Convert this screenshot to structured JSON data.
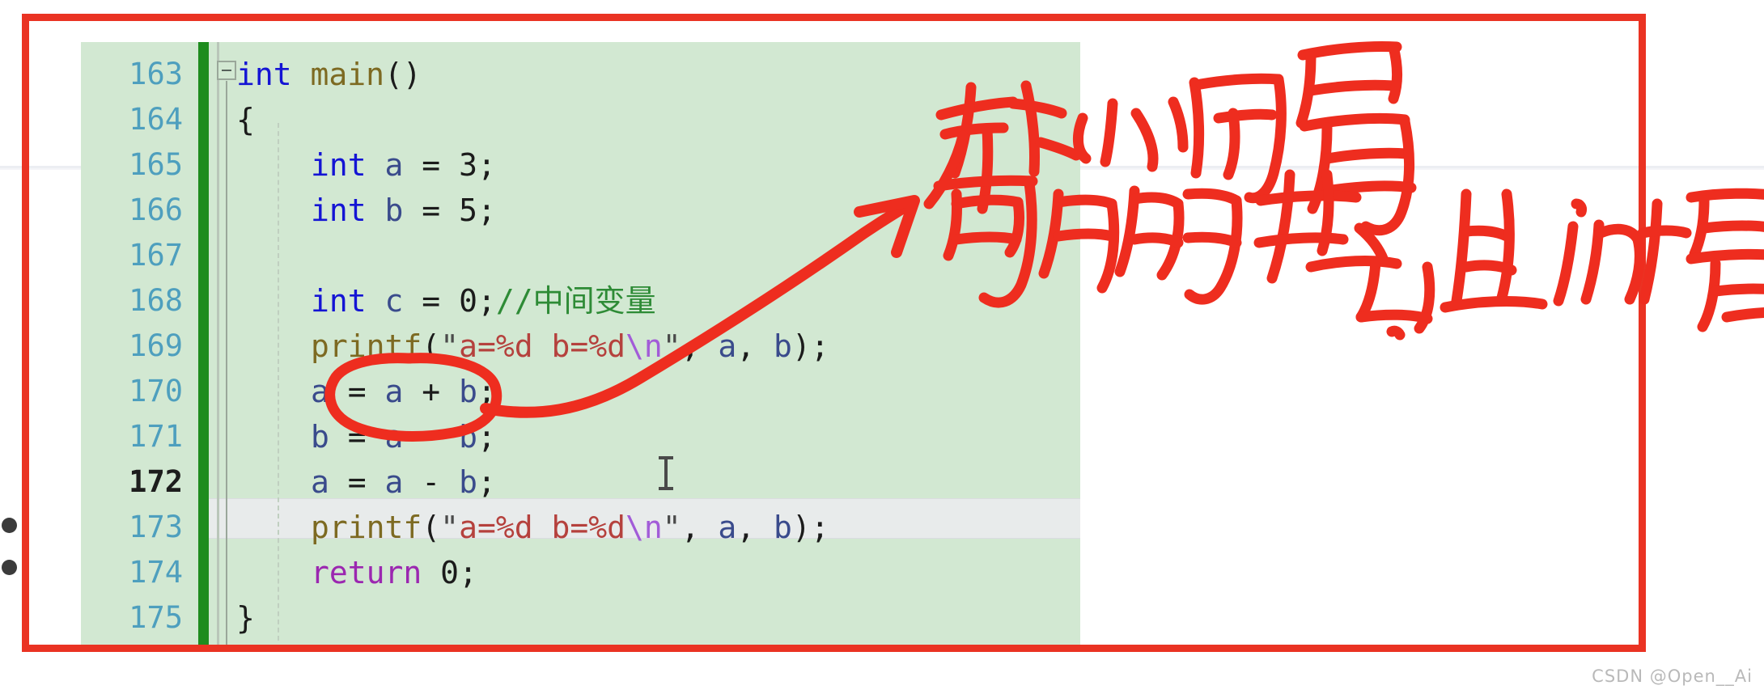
{
  "editor": {
    "background_color": "#d2e8d2",
    "gutter_color": "#4e9fbe",
    "save_marker_color": "#1e8c1e",
    "current_line_number": "172",
    "fold_icon": "collapse-minus-icon",
    "cursor_icon": "i-beam-text-cursor",
    "lines": [
      {
        "number": "163",
        "tokens": [
          {
            "t": "int",
            "c": "kw"
          },
          {
            "t": " ",
            "c": "punc"
          },
          {
            "t": "main",
            "c": "fn"
          },
          {
            "t": "()",
            "c": "punc"
          }
        ],
        "indent": 0
      },
      {
        "number": "164",
        "tokens": [
          {
            "t": "{",
            "c": "punc"
          }
        ],
        "indent": 0
      },
      {
        "number": "165",
        "tokens": [
          {
            "t": "int",
            "c": "kw"
          },
          {
            "t": " ",
            "c": "punc"
          },
          {
            "t": "a",
            "c": "id"
          },
          {
            "t": " = ",
            "c": "punc"
          },
          {
            "t": "3",
            "c": "num"
          },
          {
            "t": ";",
            "c": "punc"
          }
        ],
        "indent": 2
      },
      {
        "number": "166",
        "tokens": [
          {
            "t": "int",
            "c": "kw"
          },
          {
            "t": " ",
            "c": "punc"
          },
          {
            "t": "b",
            "c": "id"
          },
          {
            "t": " = ",
            "c": "punc"
          },
          {
            "t": "5",
            "c": "num"
          },
          {
            "t": ";",
            "c": "punc"
          }
        ],
        "indent": 2
      },
      {
        "number": "167",
        "tokens": [],
        "indent": 2
      },
      {
        "number": "168",
        "tokens": [
          {
            "t": "int",
            "c": "kw"
          },
          {
            "t": " ",
            "c": "punc"
          },
          {
            "t": "c",
            "c": "id"
          },
          {
            "t": " = ",
            "c": "punc"
          },
          {
            "t": "0",
            "c": "num"
          },
          {
            "t": ";",
            "c": "punc"
          },
          {
            "t": "//中间变量",
            "c": "cmt"
          }
        ],
        "indent": 2
      },
      {
        "number": "169",
        "tokens": [
          {
            "t": "printf",
            "c": "fn"
          },
          {
            "t": "(",
            "c": "punc"
          },
          {
            "t": "\"",
            "c": "quote"
          },
          {
            "t": "a=%d b=%d",
            "c": "str"
          },
          {
            "t": "\\n",
            "c": "esc"
          },
          {
            "t": "\"",
            "c": "quote"
          },
          {
            "t": ", ",
            "c": "punc"
          },
          {
            "t": "a",
            "c": "id"
          },
          {
            "t": ", ",
            "c": "punc"
          },
          {
            "t": "b",
            "c": "id"
          },
          {
            "t": ");",
            "c": "punc"
          }
        ],
        "indent": 2
      },
      {
        "number": "170",
        "tokens": [
          {
            "t": "a",
            "c": "id"
          },
          {
            "t": " = ",
            "c": "punc"
          },
          {
            "t": "a",
            "c": "id"
          },
          {
            "t": " + ",
            "c": "punc"
          },
          {
            "t": "b",
            "c": "id"
          },
          {
            "t": ";",
            "c": "punc"
          }
        ],
        "indent": 2
      },
      {
        "number": "171",
        "tokens": [
          {
            "t": "b",
            "c": "id"
          },
          {
            "t": " = ",
            "c": "punc"
          },
          {
            "t": "a",
            "c": "id"
          },
          {
            "t": " - ",
            "c": "punc"
          },
          {
            "t": "b",
            "c": "id"
          },
          {
            "t": ";",
            "c": "punc"
          }
        ],
        "indent": 2
      },
      {
        "number": "172",
        "tokens": [
          {
            "t": "a",
            "c": "id"
          },
          {
            "t": " = ",
            "c": "punc"
          },
          {
            "t": "a",
            "c": "id"
          },
          {
            "t": " - ",
            "c": "punc"
          },
          {
            "t": "b",
            "c": "id"
          },
          {
            "t": ";",
            "c": "punc"
          }
        ],
        "indent": 2,
        "current": true
      },
      {
        "number": "173",
        "tokens": [
          {
            "t": "printf",
            "c": "fn"
          },
          {
            "t": "(",
            "c": "punc"
          },
          {
            "t": "\"",
            "c": "quote"
          },
          {
            "t": "a=%d b=%d",
            "c": "str"
          },
          {
            "t": "\\n",
            "c": "esc"
          },
          {
            "t": "\"",
            "c": "quote"
          },
          {
            "t": ", ",
            "c": "punc"
          },
          {
            "t": "a",
            "c": "id"
          },
          {
            "t": ", ",
            "c": "punc"
          },
          {
            "t": "b",
            "c": "id"
          },
          {
            "t": ");",
            "c": "punc"
          }
        ],
        "indent": 2
      },
      {
        "number": "174",
        "tokens": [
          {
            "t": "return",
            "c": "kw2"
          },
          {
            "t": " ",
            "c": "punc"
          },
          {
            "t": "0",
            "c": "num"
          },
          {
            "t": ";",
            "c": "punc"
          }
        ],
        "indent": 2
      },
      {
        "number": "175",
        "tokens": [
          {
            "t": "}",
            "c": "punc"
          }
        ],
        "indent": 0
      }
    ]
  },
  "annotations": {
    "ink_color": "#ee2d1f",
    "border_color": "#ea3323",
    "handwriting": [
      {
        "id": "note-line-1",
        "text": "新小问题"
      },
      {
        "id": "note-line-2",
        "text": "可能超出int最大值"
      }
    ],
    "circle_label": "circle-around-a-plus-b",
    "arrow_label": "arrow-from-circle-to-note",
    "border_label": "red-highlight-rectangle"
  },
  "watermark": {
    "text": "CSDN @Open__Ai"
  }
}
